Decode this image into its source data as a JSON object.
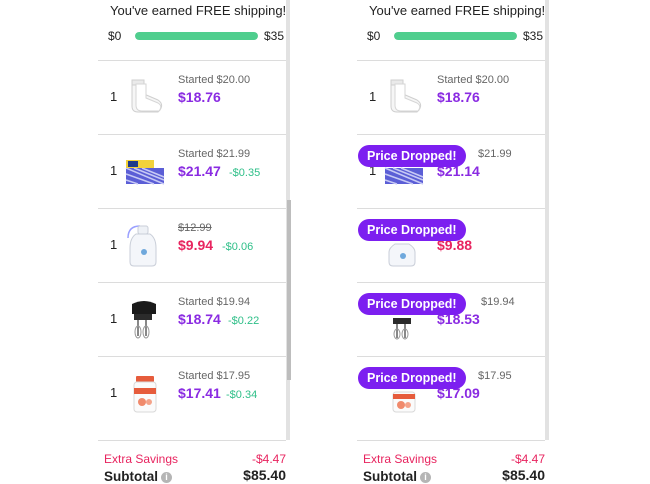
{
  "colors": {
    "brand_purple": "#8a2be2",
    "badge_purple": "#7c1ff0",
    "savings_pink": "#e8245f",
    "discount_green": "#2ebf88",
    "progress_green": "#4fce8e"
  },
  "panels": [
    {
      "shipping": {
        "message": "You've earned FREE shipping!",
        "start": "$0",
        "end": "$35",
        "progress_fraction": 1.0
      },
      "items": [
        {
          "qty": "1",
          "icon": "socks-icon",
          "started": "Started $20.00",
          "started_strike": false,
          "price": "$18.76",
          "price_color": "purple",
          "diff": "",
          "badge": ""
        },
        {
          "qty": "1",
          "icon": "box-pack-icon",
          "started": "Started $21.99",
          "started_strike": false,
          "price": "$21.47",
          "price_color": "purple",
          "diff": "-$0.35",
          "badge": ""
        },
        {
          "qty": "1",
          "icon": "bottle-icon",
          "started": "$12.99",
          "started_strike": true,
          "price": "$9.94",
          "price_color": "pink",
          "diff": "-$0.06",
          "badge": ""
        },
        {
          "qty": "1",
          "icon": "hand-mixer-icon",
          "started": "Started $19.94",
          "started_strike": false,
          "price": "$18.74",
          "price_color": "purple",
          "diff": "-$0.22",
          "badge": ""
        },
        {
          "qty": "1",
          "icon": "vitamin-bottle-icon",
          "started": "Started $17.95",
          "started_strike": false,
          "price": "$17.41",
          "price_color": "purple",
          "diff": "-$0.34",
          "badge": ""
        }
      ],
      "extra_savings_label": "Extra Savings",
      "extra_savings_value": "-$4.47",
      "subtotal_label": "Subtotal",
      "subtotal_value": "$85.40"
    },
    {
      "shipping": {
        "message": "You've earned FREE shipping!",
        "start": "$0",
        "end": "$35",
        "progress_fraction": 1.0
      },
      "items": [
        {
          "qty": "1",
          "icon": "socks-icon",
          "started": "Started $20.00",
          "started_strike": false,
          "price": "$18.76",
          "price_color": "purple",
          "diff": "",
          "badge": ""
        },
        {
          "qty": "1",
          "icon": "box-pack-icon",
          "started": "$21.99",
          "started_strike": false,
          "price": "$21.14",
          "price_color": "purple",
          "diff": "",
          "badge": "Price Dropped!"
        },
        {
          "qty": "",
          "icon": "bottle-icon",
          "started": "",
          "started_strike": false,
          "price": "$9.88",
          "price_color": "pink",
          "diff": "",
          "badge": "Price Dropped!"
        },
        {
          "qty": "",
          "icon": "hand-mixer-icon",
          "started": "$19.94",
          "started_strike": false,
          "price": "$18.53",
          "price_color": "purple",
          "diff": "",
          "badge": "Price Dropped!"
        },
        {
          "qty": "",
          "icon": "vitamin-bottle-icon",
          "started": "$17.95",
          "started_strike": false,
          "price": "$17.09",
          "price_color": "purple",
          "diff": "",
          "badge": "Price Dropped!"
        }
      ],
      "extra_savings_label": "Extra Savings",
      "extra_savings_value": "-$4.47",
      "subtotal_label": "Subtotal",
      "subtotal_value": "$85.40"
    }
  ]
}
